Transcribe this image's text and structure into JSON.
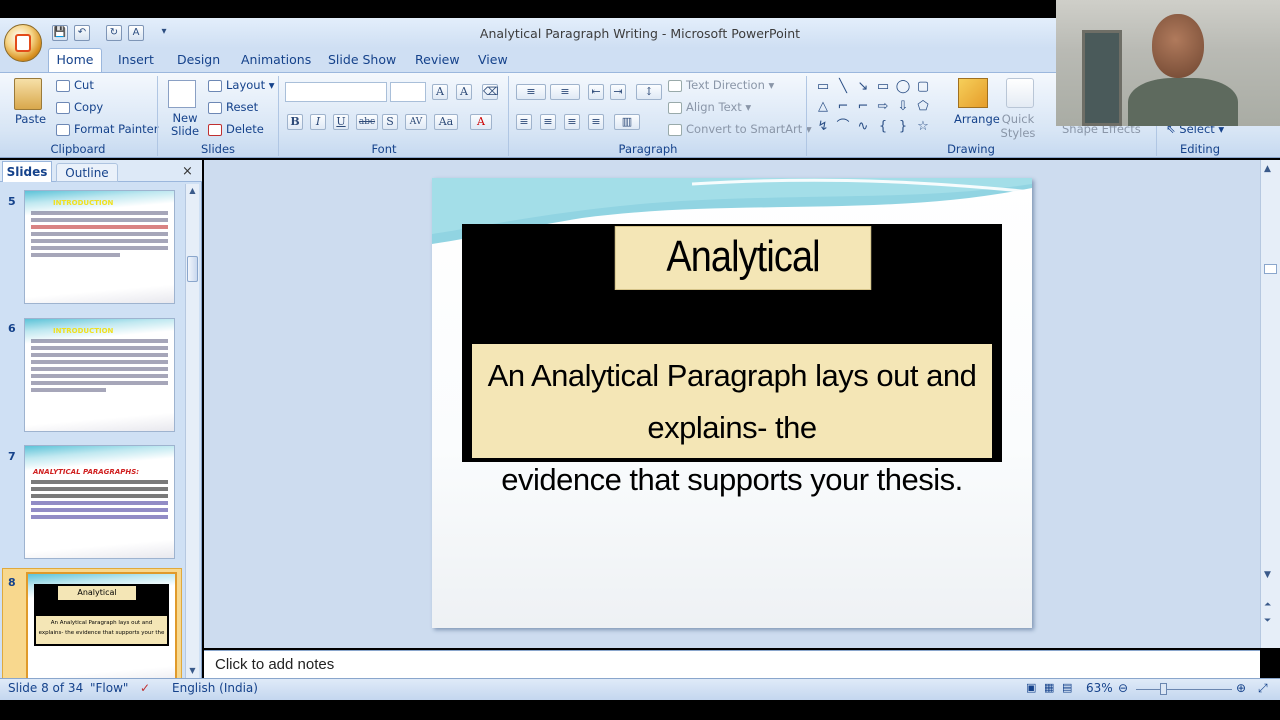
{
  "window": {
    "title": "Analytical Paragraph Writing - Microsoft PowerPoint"
  },
  "qat": {
    "save": "💾",
    "undo": "↶",
    "redo": "↻",
    "layout": "A",
    "more": "▾"
  },
  "tabs": [
    "Home",
    "Insert",
    "Design",
    "Animations",
    "Slide Show",
    "Review",
    "View"
  ],
  "ribbon": {
    "clipboard": {
      "paste": "Paste",
      "cut": "Cut",
      "copy": "Copy",
      "format_painter": "Format Painter",
      "label": "Clipboard"
    },
    "slides": {
      "new_slide": "New Slide",
      "layout": "Layout",
      "reset": "Reset",
      "delete": "Delete",
      "label": "Slides"
    },
    "font": {
      "bold": "B",
      "italic": "I",
      "underline": "U",
      "strike": "abc",
      "shadow": "S",
      "spacing": "AV",
      "case": "Aa",
      "color": "A",
      "label": "Font"
    },
    "paragraph": {
      "text_direction": "Text Direction",
      "align_text": "Align Text",
      "convert_smartart": "Convert to SmartArt",
      "label": "Paragraph"
    },
    "drawing": {
      "arrange": "Arrange",
      "quick_styles": "Quick Styles",
      "shape_effects": "Shape Effects",
      "label": "Drawing"
    },
    "editing": {
      "select": "Select",
      "label": "Editing"
    }
  },
  "panel": {
    "tab_slides": "Slides",
    "tab_outline": "Outline",
    "close": "×"
  },
  "thumbnails": [
    {
      "num": "5",
      "heading": "INTRODUCTION"
    },
    {
      "num": "6",
      "heading": "INTRODUCTION"
    },
    {
      "num": "7",
      "heading": "ANALYTICAL PARAGRAPHS:"
    },
    {
      "num": "8",
      "heading": "Analytical Paragraph",
      "body": "An Analytical Paragraph lays out and explains- the evidence that supports your the"
    }
  ],
  "slide": {
    "title": "Analytical Paragraph",
    "body_line1": "An Analytical Paragraph lays out and explains- the",
    "body_line2": "evidence that supports your thesis."
  },
  "notes": {
    "placeholder": "Click to add notes"
  },
  "status": {
    "slide_info": "Slide 8 of 34",
    "theme": "\"Flow\"",
    "language": "English (India)",
    "zoom": "63%"
  },
  "colors": {
    "ribbon": "#d7e5f5",
    "accent": "#15428b",
    "slide_box": "#f4e6b6",
    "selected_thumb": "#f8d88e"
  }
}
